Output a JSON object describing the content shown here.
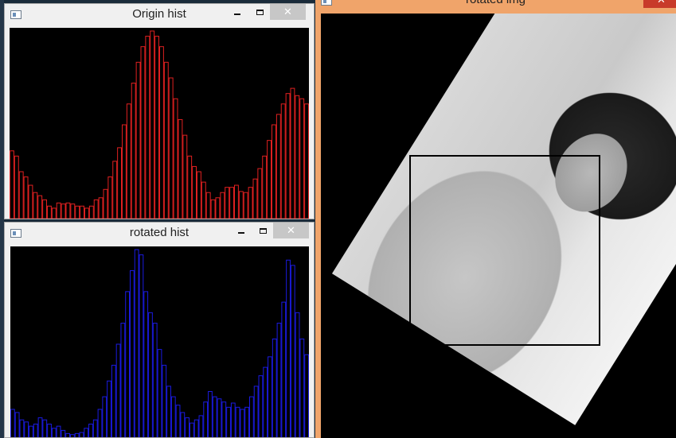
{
  "windows": {
    "origin_hist": {
      "title": "Origin hist",
      "color": "#e02020"
    },
    "rotated_hist": {
      "title": "rotated hist",
      "color": "#1a1ae0"
    },
    "rotated_img": {
      "title": "rotated img"
    }
  },
  "controls": {
    "minimize": "–",
    "maximize": "□",
    "close": "✕"
  },
  "chart_data": [
    {
      "type": "bar",
      "name": "Origin hist",
      "values": [
        65,
        60,
        45,
        40,
        32,
        25,
        22,
        18,
        12,
        10,
        15,
        14,
        15,
        14,
        12,
        12,
        10,
        12,
        18,
        20,
        28,
        40,
        55,
        68,
        90,
        110,
        130,
        150,
        165,
        175,
        180,
        175,
        165,
        150,
        135,
        115,
        95,
        80,
        60,
        50,
        45,
        35,
        25,
        18,
        20,
        25,
        30,
        30,
        32,
        26,
        25,
        30,
        38,
        48,
        60,
        75,
        90,
        100,
        110,
        120,
        125,
        118,
        115,
        110
      ]
    },
    {
      "type": "bar",
      "name": "rotated hist",
      "values": [
        28,
        25,
        18,
        16,
        12,
        14,
        20,
        18,
        14,
        10,
        12,
        8,
        5,
        4,
        5,
        6,
        10,
        14,
        18,
        28,
        40,
        55,
        70,
        90,
        110,
        140,
        160,
        180,
        175,
        140,
        120,
        110,
        85,
        70,
        50,
        40,
        32,
        25,
        20,
        15,
        18,
        22,
        35,
        45,
        40,
        38,
        35,
        30,
        34,
        30,
        28,
        30,
        40,
        50,
        60,
        68,
        78,
        95,
        110,
        130,
        170,
        165,
        120,
        95,
        80
      ]
    }
  ]
}
